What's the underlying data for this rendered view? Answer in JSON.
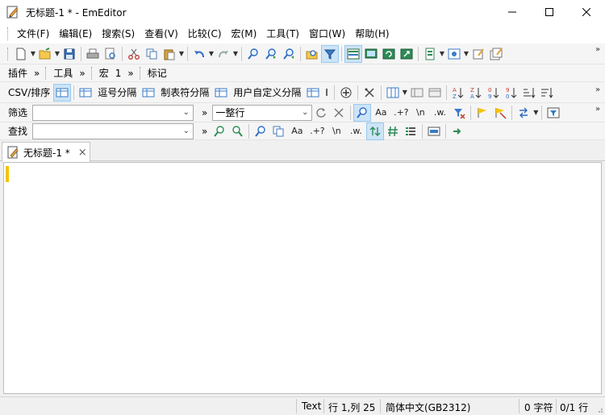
{
  "window": {
    "title": "无标题-1 * - EmEditor"
  },
  "menu": [
    "文件(F)",
    "编辑(E)",
    "搜索(S)",
    "查看(V)",
    "比较(C)",
    "宏(M)",
    "工具(T)",
    "窗口(W)",
    "帮助(H)"
  ],
  "bars": {
    "plugins": "插件",
    "tools": "工具",
    "macros": "宏",
    "macros_extra": "1",
    "markers": "标记",
    "chevron": "»"
  },
  "csv": {
    "label": "CSV/排序",
    "comma": "逗号分隔",
    "tab": "制表符分隔",
    "user": "用户自定义分隔",
    "more": "I"
  },
  "filter": {
    "label": "筛选",
    "input_value": "",
    "mode": "一整行",
    "aa": "Aa",
    "regex": ".+?",
    "newline": "\\n",
    "word": ".w."
  },
  "find": {
    "label": "查找",
    "input_value": "",
    "aa": "Aa",
    "regex": ".+?",
    "newline": "\\n",
    "word": ".w."
  },
  "tab": {
    "label": "无标题-1 *",
    "close": "×"
  },
  "status": {
    "mode": "Text",
    "position": "行 1,列 25",
    "encoding": "简体中文(GB2312)",
    "chars": "0 字符",
    "lines": "0/1 行"
  },
  "colors": {
    "cursor": "#f5c400",
    "selected": "#cce4f7"
  }
}
